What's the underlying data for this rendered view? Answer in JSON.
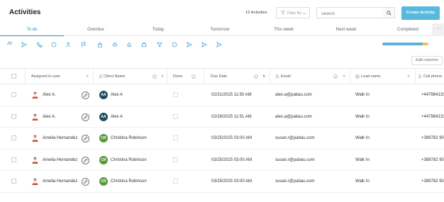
{
  "header": {
    "title": "Activities",
    "count": "15 Activities",
    "filter_label": "Filter By",
    "search_placeholder": "Search",
    "create_label": "Create Activity"
  },
  "tabs": [
    "To do",
    "Overdue",
    "Today",
    "Tomorrow",
    "This week",
    "Next week",
    "Completed"
  ],
  "tabs_more": "···",
  "type_filter": {
    "all_label": "All",
    "icons": [
      "send-icon",
      "phone-icon",
      "chat-icon",
      "people-icon",
      "flag-icon",
      "lock-icon",
      "car-icon",
      "bell-icon",
      "briefcase-icon",
      "filter-icon",
      "chat-bubble-icon",
      "send-icon",
      "send-icon",
      "send-icon"
    ]
  },
  "progress": {
    "blue_fraction": 0.87,
    "yellow_fraction": 0.1
  },
  "edit_columns_label": "Edit columns",
  "columns": {
    "assigned": "Assigned to user",
    "client": "Client Name",
    "done": "Done",
    "due": "Due Date",
    "email": "Email",
    "lead": "Lead name",
    "cell": "Cell phone"
  },
  "rows": [
    {
      "user": "Alex A.",
      "initials": "AA",
      "client": "Alex A",
      "due": "02/21/2025 11:50 AM",
      "email": "alex.a@pabau.com",
      "lead": "Walk In",
      "phone": "+447984131",
      "badge_color": "#1f4e5e"
    },
    {
      "user": "Alex A.",
      "initials": "AA",
      "client": "Alex A",
      "due": "02/28/2025 11:51 AM",
      "email": "alex.a@pabau.com",
      "lead": "Walk In",
      "phone": "+447984131",
      "badge_color": "#1f4e5e"
    },
    {
      "user": "Amelia Hernandez",
      "initials": "CR",
      "client": "Christina Robinson",
      "due": "03/25/2025 03:00 AM",
      "email": "susan.r@pabau.com",
      "lead": "Walk In",
      "phone": "+389782 90",
      "badge_color": "#5a9a3c"
    },
    {
      "user": "Amelia Hernandez",
      "initials": "CR",
      "client": "Christina Robinson",
      "due": "03/25/2025 03:00 AM",
      "email": "susan.r@pabau.com",
      "lead": "Walk In",
      "phone": "+389782 90",
      "badge_color": "#5a9a3c"
    },
    {
      "user": "Amelia Hernandez",
      "initials": "CR",
      "client": "Christina Robinson",
      "due": "03/25/2025 03:00 AM",
      "email": "susan.r@pabau.com",
      "lead": "Walk In",
      "phone": "+389782 90",
      "badge_color": "#5a9a3c"
    }
  ]
}
